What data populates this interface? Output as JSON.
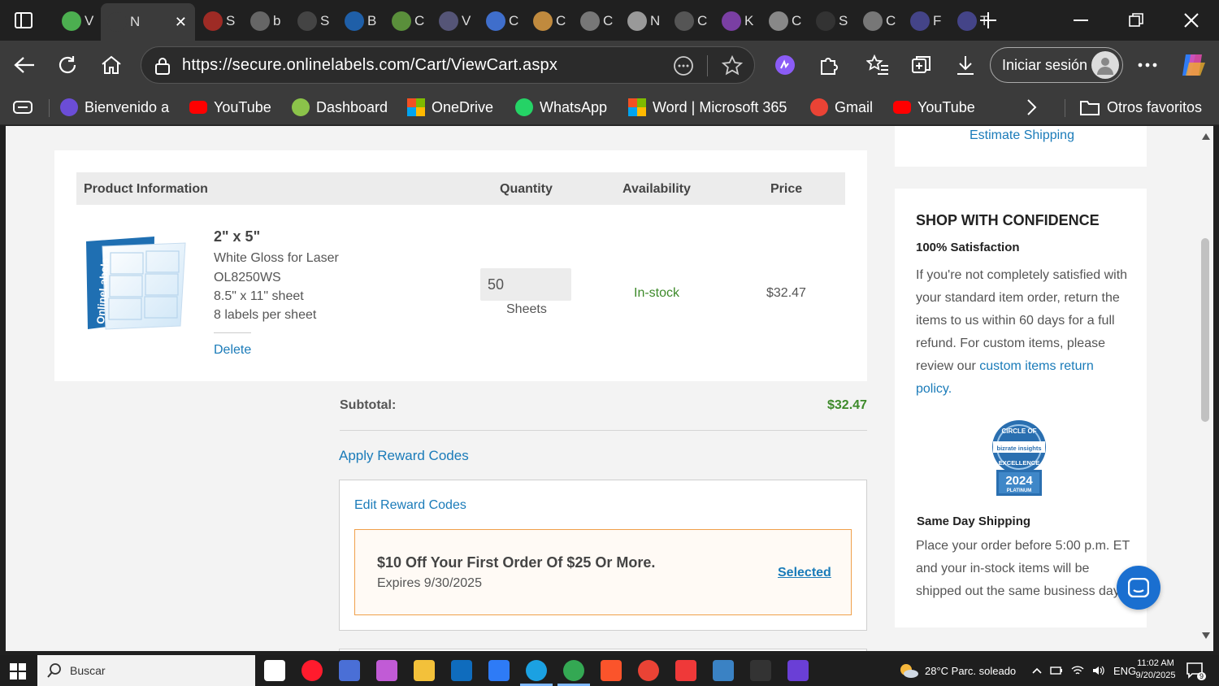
{
  "browser": {
    "tabs": [
      {
        "label": "V",
        "active": false,
        "color": "#4caf50"
      },
      {
        "label": "N",
        "active": true,
        "color": "#3b3b3b"
      },
      {
        "label": "S",
        "active": false,
        "color": "#9e2b25"
      },
      {
        "label": "b",
        "active": false,
        "color": "#666666"
      },
      {
        "label": "S",
        "active": false,
        "color": "#444444"
      },
      {
        "label": "B",
        "active": false,
        "color": "#1f5fa8"
      },
      {
        "label": "C",
        "active": false,
        "color": "#5a8f3b"
      },
      {
        "label": "V",
        "active": false,
        "color": "#555577"
      },
      {
        "label": "C",
        "active": false,
        "color": "#3f6ecb"
      },
      {
        "label": "C",
        "active": false,
        "color": "#c08a3e"
      },
      {
        "label": "C",
        "active": false,
        "color": "#777777"
      },
      {
        "label": "N",
        "active": false,
        "color": "#999999"
      },
      {
        "label": "C",
        "active": false,
        "color": "#555555"
      },
      {
        "label": "K",
        "active": false,
        "color": "#7a3fa3"
      },
      {
        "label": "C",
        "active": false,
        "color": "#888888"
      },
      {
        "label": "S",
        "active": false,
        "color": "#333333"
      },
      {
        "label": "C",
        "active": false,
        "color": "#777777"
      },
      {
        "label": "F",
        "active": false,
        "color": "#444488"
      },
      {
        "label": "T",
        "active": false,
        "color": "#444488"
      }
    ],
    "url": "https://secure.onlinelabels.com/Cart/ViewCart.aspx",
    "signin_label": "Iniciar sesión",
    "bookmarks": [
      {
        "label": "Bienvenido a",
        "icon": "purple-square-icon",
        "color": "#6b4dd6"
      },
      {
        "label": "YouTube",
        "icon": "youtube-icon",
        "color": "#ff0000"
      },
      {
        "label": "Dashboard",
        "icon": "dashboard-icon",
        "color": "#8bc34a"
      },
      {
        "label": "OneDrive",
        "icon": "microsoft-icon",
        "color": "#f25022"
      },
      {
        "label": "WhatsApp",
        "icon": "whatsapp-icon",
        "color": "#25d366"
      },
      {
        "label": "Word | Microsoft 365",
        "icon": "microsoft-icon",
        "color": "#f25022"
      },
      {
        "label": "Gmail",
        "icon": "gmail-icon",
        "color": "#ea4335"
      },
      {
        "label": "YouTube",
        "icon": "youtube-icon",
        "color": "#ff0000"
      }
    ],
    "other_favorites": "Otros favoritos"
  },
  "cart": {
    "estimate_shipping": "Estimate Shipping",
    "headers": {
      "product": "Product Information",
      "quantity": "Quantity",
      "availability": "Availability",
      "price": "Price"
    },
    "item": {
      "size": "2\" x 5\"",
      "material": "White Gloss for Laser",
      "sku": "OL8250WS",
      "sheet": "8.5\" x 11\" sheet",
      "per_sheet": "8 labels per sheet",
      "delete": "Delete",
      "quantity": "50",
      "unit": "Sheets",
      "availability": "In-stock",
      "price": "$32.47",
      "brand": "OnlineLabels"
    },
    "subtotal_label": "Subtotal:",
    "subtotal_value": "$32.47",
    "apply_reward": "Apply Reward Codes",
    "edit_reward": "Edit Reward Codes",
    "reward": {
      "title": "$10 Off Your First Order Of $25 Or More.",
      "expires": "Expires 9/30/2025",
      "status": "Selected"
    }
  },
  "confidence": {
    "title": "SHOP WITH CONFIDENCE",
    "satisfaction_title": "100% Satisfaction",
    "satisfaction_text": "If you're not completely satisfied with your standard item order, return the items to us within 60 days for a full refund. For custom items, please review our",
    "satisfaction_link": "custom items return policy",
    "badge_top": "CIRCLE OF",
    "badge_brand": "bizrate insights",
    "badge_bottom": "EXCELLENCE",
    "badge_year": "2024",
    "badge_tier": "PLATINUM",
    "shipping_title": "Same Day Shipping",
    "shipping_text": "Place your order before 5:00 p.m. ET and your in-stock items will be shipped out the same business day."
  },
  "taskbar": {
    "search_placeholder": "Buscar",
    "weather": "28°C  Parc. soleado",
    "language": "ENG",
    "time": "11:02 AM",
    "date": "9/20/2025",
    "notifications": "9"
  },
  "colors": {
    "accent_link": "#1a7bb9",
    "in_stock": "#3d8a2a",
    "subtotal": "#3d8a2a",
    "reward_border": "#f0a04b",
    "reward_bg": "#fffaf5",
    "chat_button": "#1a6fd0"
  }
}
